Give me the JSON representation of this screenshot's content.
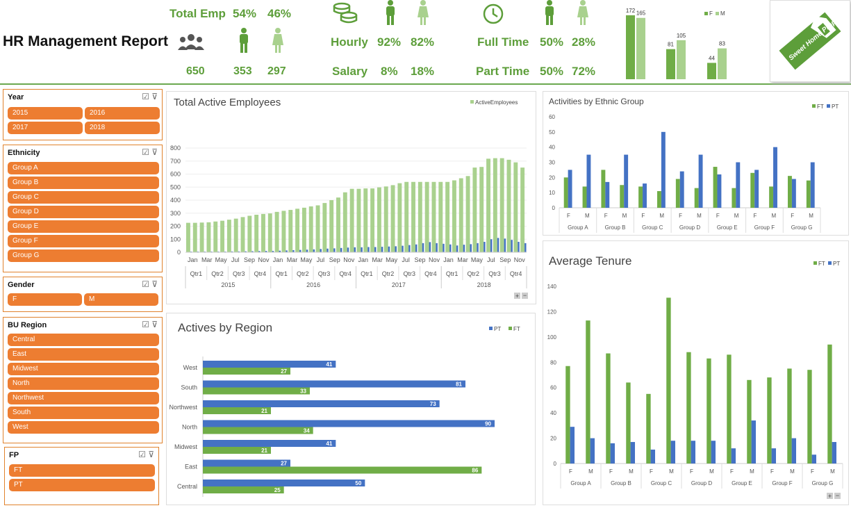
{
  "header": {
    "title": "HR Management Report",
    "total_emp_label": "Total Emp",
    "male_pct": "54%",
    "female_pct": "46%",
    "total_emp": "650",
    "male_count": "353",
    "female_count": "297",
    "hourly_label": "Hourly",
    "hourly_m": "92%",
    "hourly_f": "82%",
    "salary_label": "Salary",
    "salary_m": "8%",
    "salary_f": "18%",
    "fulltime_label": "Full Time",
    "fulltime_m": "50%",
    "fulltime_f": "28%",
    "parttime_label": "Part Time",
    "parttime_m": "50%",
    "parttime_f": "72%",
    "logo_text": "Sweet Home Properties"
  },
  "mini_chart": {
    "legend": [
      "F",
      "M"
    ],
    "pairs": [
      [
        172,
        165
      ],
      [
        81,
        105
      ],
      [
        44,
        83
      ]
    ],
    "colors": [
      "#70ad47",
      "#a9d18e"
    ]
  },
  "slicers": {
    "year": {
      "title": "Year",
      "items": [
        "2015",
        "2016",
        "2017",
        "2018"
      ]
    },
    "ethnicity": {
      "title": "Ethnicity",
      "items": [
        "Group A",
        "Group B",
        "Group C",
        "Group D",
        "Group E",
        "Group F",
        "Group G"
      ]
    },
    "gender": {
      "title": "Gender",
      "items": [
        "F",
        "M"
      ]
    },
    "region": {
      "title": "BU Region",
      "items": [
        "Central",
        "East",
        "Midwest",
        "North",
        "Northwest",
        "South",
        "West"
      ]
    },
    "fp": {
      "title": "FP",
      "items": [
        "FT",
        "PT"
      ]
    }
  },
  "chart_data": [
    {
      "type": "bar",
      "title": "Total Active Employees",
      "legend": [
        "ActiveEmployees"
      ],
      "ylim": [
        0,
        800
      ],
      "yticks": [
        0,
        100,
        200,
        300,
        400,
        500,
        600,
        700,
        800
      ],
      "month_labels": [
        "Jan",
        "Mar",
        "May",
        "Jul",
        "Sep",
        "Nov",
        "Jan",
        "Mar",
        "May",
        "Jul",
        "Sep",
        "Nov",
        "Jan",
        "Mar",
        "May",
        "Jul",
        "Sep",
        "Nov",
        "Jan",
        "Mar",
        "May",
        "Jul",
        "Sep",
        "Nov"
      ],
      "quarter_labels": [
        "Qtr1",
        "Qtr2",
        "Qtr3",
        "Qtr4",
        "Qtr1",
        "Qtr2",
        "Qtr3",
        "Qtr4",
        "Qtr1",
        "Qtr2",
        "Qtr3",
        "Qtr4",
        "Qtr1",
        "Qtr2",
        "Qtr3",
        "Qtr4"
      ],
      "year_labels": [
        "2015",
        "2016",
        "2017",
        "2018"
      ],
      "series": [
        {
          "name": "ActiveEmployees",
          "color": "#a9d18e",
          "values": [
            226,
            226,
            228,
            230,
            236,
            242,
            250,
            258,
            270,
            280,
            288,
            294,
            298,
            310,
            318,
            325,
            334,
            342,
            352,
            360,
            378,
            400,
            420,
            460,
            487,
            487,
            490,
            490,
            498,
            505,
            515,
            530,
            540,
            540,
            540,
            540,
            540,
            540,
            540,
            552,
            568,
            585,
            650,
            655,
            718,
            722,
            722,
            710,
            690,
            650
          ]
        },
        {
          "name": "",
          "color": "#4472c4",
          "values": [
            5,
            5,
            5,
            5,
            5,
            5,
            6,
            6,
            7,
            8,
            9,
            10,
            10,
            12,
            14,
            16,
            18,
            20,
            22,
            25,
            28,
            30,
            33,
            36,
            38,
            38,
            40,
            40,
            42,
            44,
            46,
            50,
            55,
            60,
            70,
            78,
            70,
            65,
            60,
            52,
            58,
            62,
            70,
            80,
            100,
            110,
            105,
            95,
            80,
            70
          ]
        }
      ]
    },
    {
      "type": "bar",
      "title": "Actives by Region",
      "legend": [
        "PT",
        "FT"
      ],
      "categories": [
        "West",
        "South",
        "Northwest",
        "North",
        "Midwest",
        "East",
        "Central"
      ],
      "series": [
        {
          "name": "PT",
          "color": "#4472c4",
          "values": [
            41,
            81,
            73,
            90,
            41,
            27,
            50
          ]
        },
        {
          "name": "FT",
          "color": "#70ad47",
          "values": [
            27,
            33,
            21,
            34,
            21,
            86,
            25
          ]
        }
      ]
    },
    {
      "type": "bar",
      "title": "Activities by Ethnic Group",
      "legend": [
        "FT",
        "PT"
      ],
      "ylim": [
        0,
        60
      ],
      "yticks": [
        0,
        10,
        20,
        30,
        40,
        50,
        60
      ],
      "groups": [
        "Group A",
        "Group B",
        "Group C",
        "Group D",
        "Group E",
        "Group F",
        "Group G"
      ],
      "sub_categories": [
        "F",
        "M"
      ],
      "series": [
        {
          "name": "FT",
          "color": "#70ad47",
          "values": [
            20,
            14,
            25,
            15,
            14,
            11,
            19,
            13,
            27,
            13,
            23,
            14,
            21,
            18
          ]
        },
        {
          "name": "PT",
          "color": "#4472c4",
          "values": [
            25,
            35,
            17,
            35,
            16,
            50,
            24,
            35,
            22,
            30,
            25,
            40,
            19,
            30
          ]
        }
      ]
    },
    {
      "type": "bar",
      "title": "Average Tenure",
      "legend": [
        "FT",
        "PT"
      ],
      "ylim": [
        0,
        140
      ],
      "yticks": [
        0,
        20,
        40,
        60,
        80,
        100,
        120,
        140
      ],
      "groups": [
        "Group A",
        "Group B",
        "Group C",
        "Group D",
        "Group E",
        "Group F",
        "Group G"
      ],
      "sub_categories": [
        "F",
        "M"
      ],
      "series": [
        {
          "name": "FT",
          "color": "#70ad47",
          "values": [
            77,
            113,
            87,
            64,
            55,
            131,
            88,
            83,
            86,
            66,
            68,
            75,
            74,
            94
          ]
        },
        {
          "name": "PT",
          "color": "#4472c4",
          "values": [
            29,
            20,
            16,
            17,
            11,
            18,
            18,
            18,
            12,
            34,
            12,
            20,
            7,
            17
          ]
        }
      ]
    }
  ]
}
